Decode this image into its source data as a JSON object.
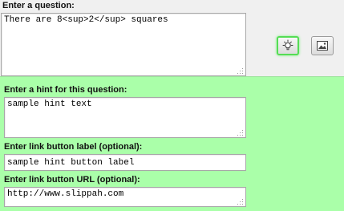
{
  "question": {
    "label": "Enter a question:",
    "value": "There are 8<sup>2</sup> squares"
  },
  "toolbar": {
    "hint_icon": "lightbulb-icon",
    "hint_active": true,
    "image_icon": "image-icon"
  },
  "hint": {
    "panel_color": "#aaffa9",
    "label": "Enter a hint for this question:",
    "value": "sample hint text",
    "link_label_label": "Enter link button label (optional):",
    "link_label_value": "sample hint button label",
    "link_url_label": "Enter link button URL (optional):",
    "link_url_value": "http://www.slippah.com"
  }
}
